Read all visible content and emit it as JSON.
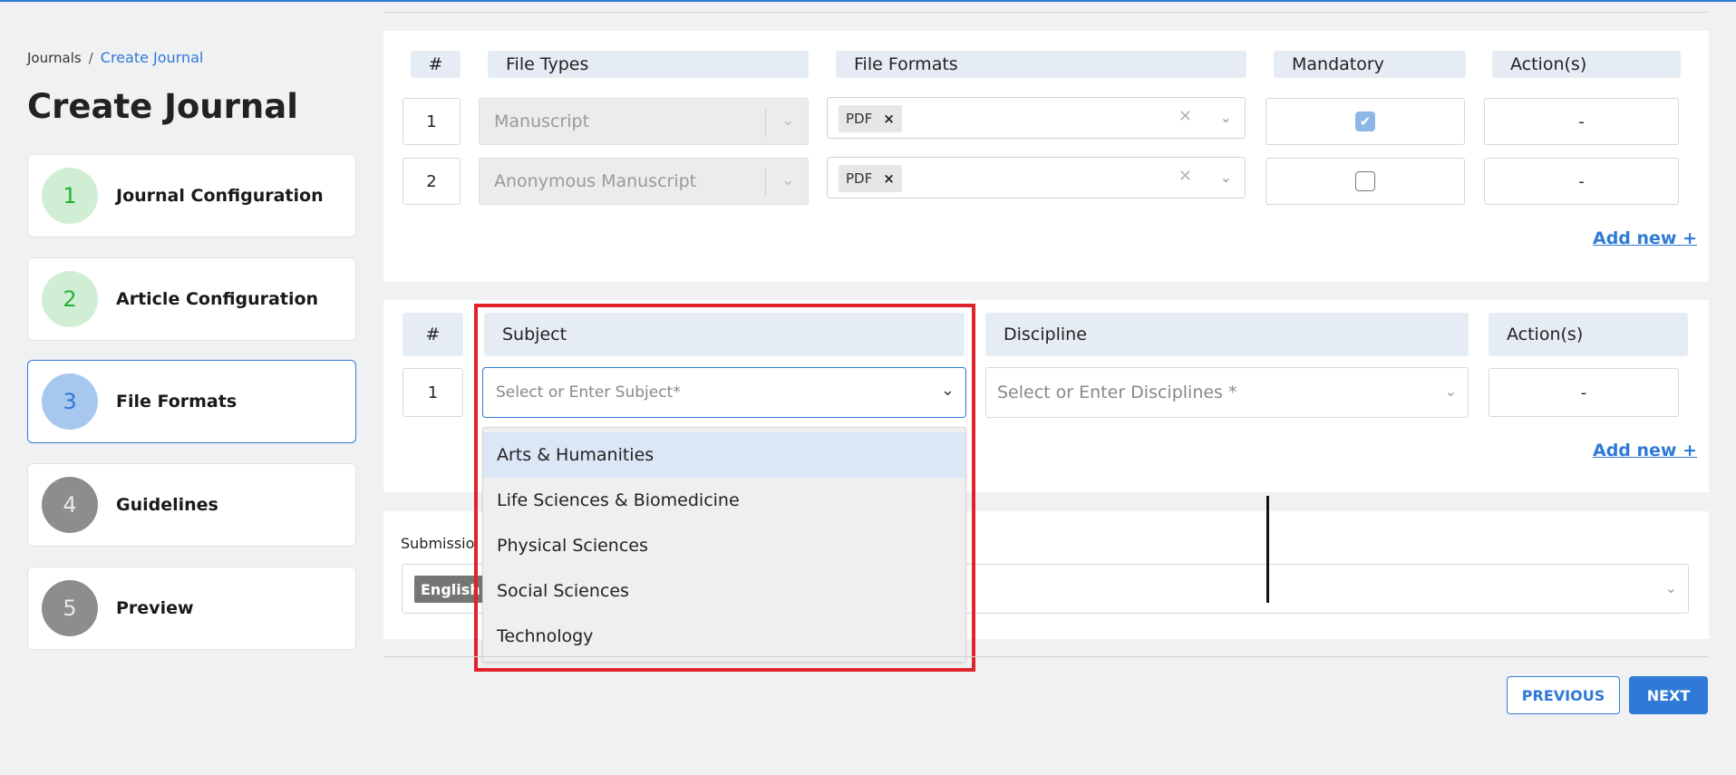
{
  "breadcrumb": {
    "root": "Journals",
    "separator": "/",
    "current": "Create Journal"
  },
  "page_title": "Create Journal",
  "steps": [
    {
      "number": "1",
      "label": "Journal Configuration",
      "state": "done"
    },
    {
      "number": "2",
      "label": "Article Configuration",
      "state": "done"
    },
    {
      "number": "3",
      "label": "File Formats",
      "state": "active"
    },
    {
      "number": "4",
      "label": "Guidelines",
      "state": "pending"
    },
    {
      "number": "5",
      "label": "Preview",
      "state": "pending"
    }
  ],
  "file_formats_table": {
    "headers": {
      "num": "#",
      "file_types": "File Types",
      "file_formats": "File Formats",
      "mandatory": "Mandatory",
      "actions": "Action(s)"
    },
    "rows": [
      {
        "num": "1",
        "file_type": "Manuscript",
        "format_chip": "PDF",
        "mandatory": true,
        "action": "-"
      },
      {
        "num": "2",
        "file_type": "Anonymous Manuscript",
        "format_chip": "PDF",
        "mandatory": false,
        "action": "-"
      }
    ],
    "add_new": "Add new +"
  },
  "subject_table": {
    "headers": {
      "num": "#",
      "subject": "Subject",
      "discipline": "Discipline",
      "actions": "Action(s)"
    },
    "row": {
      "num": "1",
      "subject_placeholder": "Select or Enter Subject*",
      "discipline_placeholder": "Select or Enter Disciplines *",
      "action": "-"
    },
    "dropdown_options": [
      "Arts & Humanities",
      "Life Sciences & Biomedicine",
      "Physical Sciences",
      "Social Sciences",
      "Technology"
    ],
    "add_new": "Add new +"
  },
  "submission": {
    "label_visible": "Submissio",
    "chip": "English"
  },
  "buttons": {
    "previous": "PREVIOUS",
    "next": "NEXT"
  },
  "colors": {
    "accent": "#2f7ad6",
    "highlight": "#e0222b",
    "done": "#22b33a"
  }
}
